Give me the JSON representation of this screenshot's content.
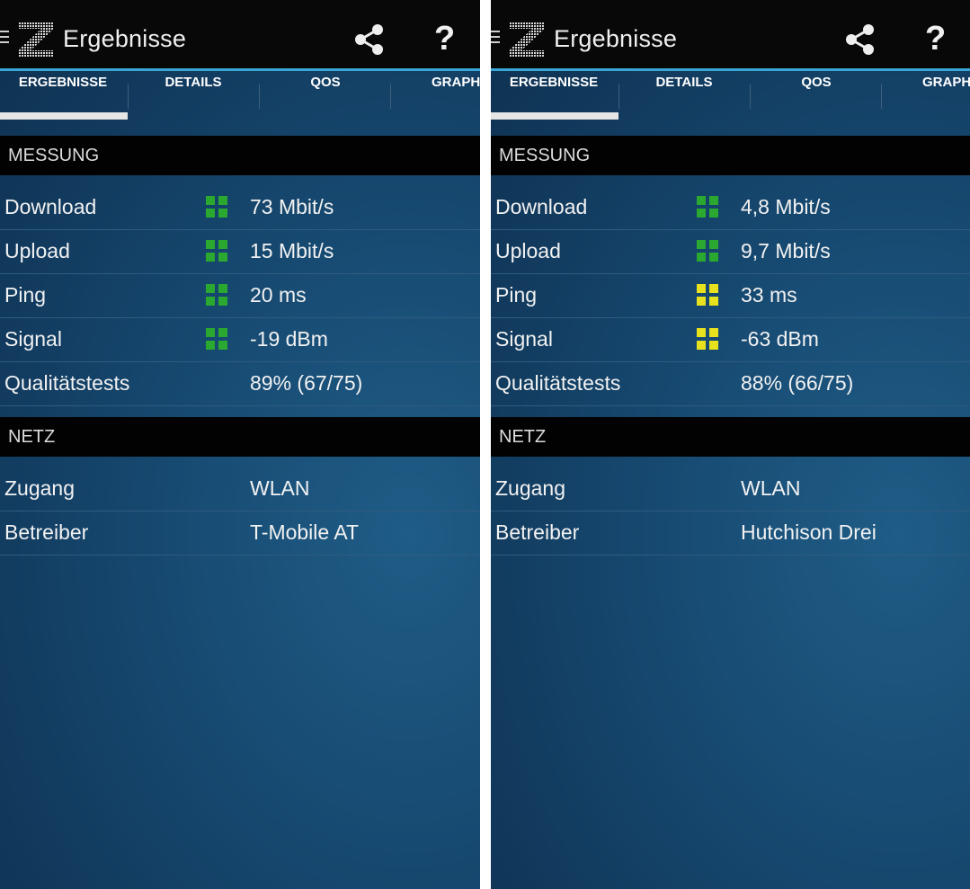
{
  "panels": [
    {
      "header": {
        "title": "Ergebnisse"
      },
      "tabs": [
        "ERGEBNISSE",
        "DETAILS",
        "QOS",
        "GRAPH"
      ],
      "messung": {
        "title": "MESSUNG",
        "rows": [
          {
            "label": "Download",
            "value": "73 Mbit/s",
            "indicator": "green"
          },
          {
            "label": "Upload",
            "value": "15 Mbit/s",
            "indicator": "green"
          },
          {
            "label": "Ping",
            "value": "20 ms",
            "indicator": "green"
          },
          {
            "label": "Signal",
            "value": "-19 dBm",
            "indicator": "green"
          },
          {
            "label": "Qualitätstests",
            "value": "89% (67/75)"
          }
        ]
      },
      "netz": {
        "title": "NETZ",
        "rows": [
          {
            "label": "Zugang",
            "value": "WLAN"
          },
          {
            "label": "Betreiber",
            "value": "T-Mobile AT"
          }
        ]
      }
    },
    {
      "header": {
        "title": "Ergebnisse"
      },
      "tabs": [
        "ERGEBNISSE",
        "DETAILS",
        "QOS",
        "GRAPH"
      ],
      "messung": {
        "title": "MESSUNG",
        "rows": [
          {
            "label": "Download",
            "value": "4,8 Mbit/s",
            "indicator": "green"
          },
          {
            "label": "Upload",
            "value": "9,7 Mbit/s",
            "indicator": "green"
          },
          {
            "label": "Ping",
            "value": "33 ms",
            "indicator": "yellow"
          },
          {
            "label": "Signal",
            "value": "-63 dBm",
            "indicator": "yellow"
          },
          {
            "label": "Qualitätstests",
            "value": "88% (66/75)"
          }
        ]
      },
      "netz": {
        "title": "NETZ",
        "rows": [
          {
            "label": "Zugang",
            "value": "WLAN"
          },
          {
            "label": "Betreiber",
            "value": "Hutchison Drei"
          }
        ]
      }
    }
  ],
  "colors": {
    "green": "#2aa830",
    "yellow": "#e8e21e",
    "accent": "#3aa6d6"
  },
  "icons": [
    "menu-icon",
    "app-logo-icon",
    "share-icon",
    "help-icon"
  ]
}
